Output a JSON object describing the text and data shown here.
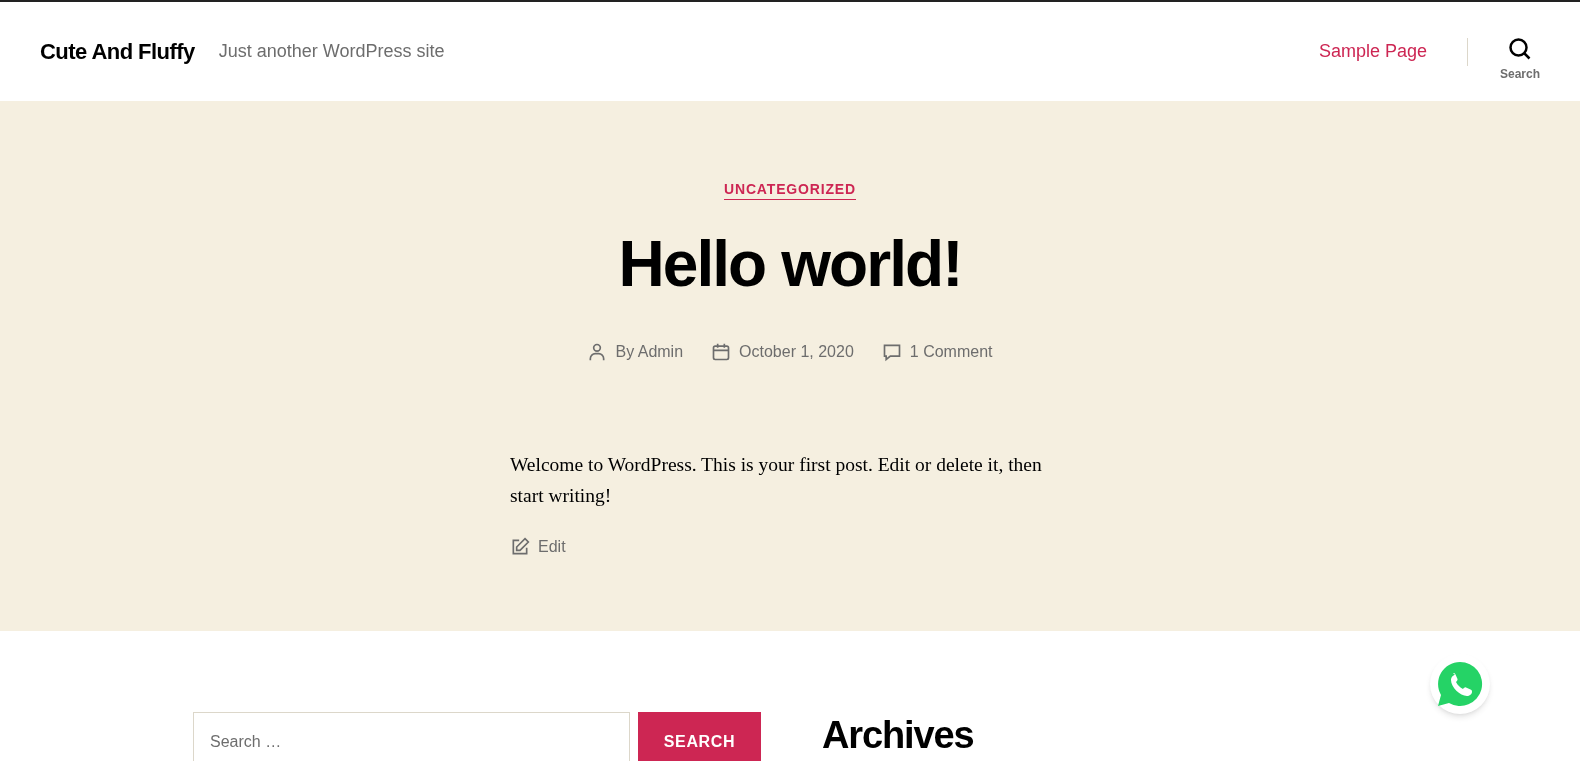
{
  "header": {
    "site_title": "Cute And Fluffy",
    "tagline": "Just another WordPress site",
    "nav": [
      {
        "label": "Sample Page"
      }
    ],
    "search_toggle": {
      "label": "Search"
    }
  },
  "post": {
    "category": "UNCATEGORIZED",
    "title": "Hello world!",
    "meta": [
      {
        "kind": "author",
        "text": "By Admin"
      },
      {
        "kind": "date",
        "text": "October 1, 2020"
      },
      {
        "kind": "comments",
        "text": "1 Comment"
      }
    ],
    "body": "Welcome to WordPress. This is your first post. Edit or delete it, then start writing!",
    "edit_link": "Edit"
  },
  "widgets": {
    "search": {
      "placeholder": "Search …",
      "button": "SEARCH"
    },
    "archives_title": "Archives"
  }
}
